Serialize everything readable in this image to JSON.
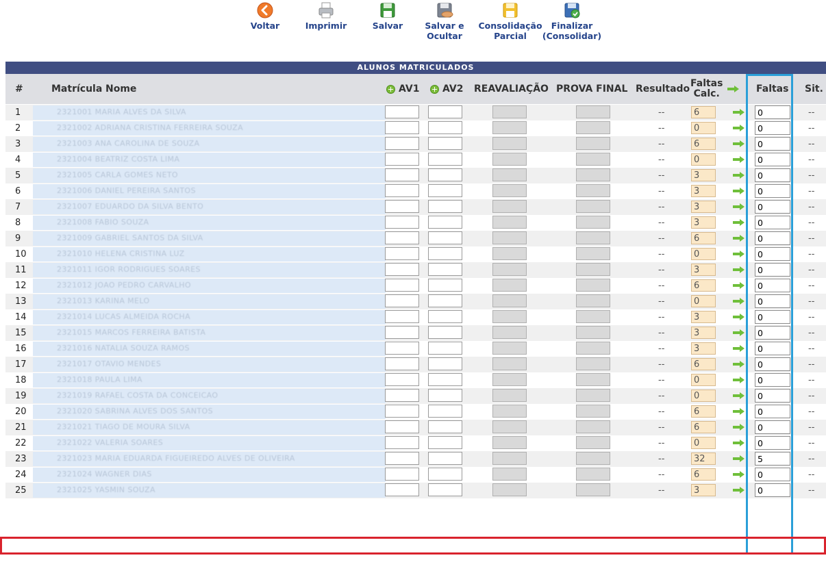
{
  "toolbar": {
    "buttons": [
      {
        "label": "Voltar",
        "icon": "back-icon"
      },
      {
        "label": "Imprimir",
        "icon": "printer-icon"
      },
      {
        "label": "Salvar",
        "icon": "save-icon"
      },
      {
        "label": "Salvar e\nOcultar",
        "icon": "save-hide-icon"
      },
      {
        "label": "Consolidação\nParcial",
        "icon": "partial-consolidation-icon"
      },
      {
        "label": "Finalizar\n(Consolidar)",
        "icon": "finalize-icon"
      }
    ]
  },
  "table": {
    "caption": "Alunos matriculados",
    "headers": {
      "num": "#",
      "matricula": "Matrícula",
      "nome": "Nome",
      "av1": "AV1",
      "av2": "AV2",
      "reavaliacao": "REAVALIAÇÃO",
      "prova_final": "PROVA FINAL",
      "resultado": "Resultado",
      "faltas_calc": "Faltas\nCalc.",
      "faltas": "Faltas",
      "sit": "Sit."
    },
    "rows": [
      {
        "n": "1",
        "faltas_calc": "6",
        "faltas": "0",
        "resultado": "--",
        "sit": "--",
        "blur": "2321001  MARIA ALVES DA SILVA"
      },
      {
        "n": "2",
        "faltas_calc": "0",
        "faltas": "0",
        "resultado": "--",
        "sit": "--",
        "blur": "2321002  ADRIANA CRISTINA FERREIRA SOUZA"
      },
      {
        "n": "3",
        "faltas_calc": "6",
        "faltas": "0",
        "resultado": "--",
        "sit": "--",
        "blur": "2321003  ANA CAROLINA DE SOUZA"
      },
      {
        "n": "4",
        "faltas_calc": "0",
        "faltas": "0",
        "resultado": "--",
        "sit": "--",
        "blur": "2321004  BEATRIZ COSTA LIMA"
      },
      {
        "n": "5",
        "faltas_calc": "3",
        "faltas": "0",
        "resultado": "--",
        "sit": "--",
        "blur": "2321005  CARLA GOMES NETO"
      },
      {
        "n": "6",
        "faltas_calc": "3",
        "faltas": "0",
        "resultado": "--",
        "sit": "--",
        "blur": "2321006  DANIEL PEREIRA SANTOS"
      },
      {
        "n": "7",
        "faltas_calc": "3",
        "faltas": "0",
        "resultado": "--",
        "sit": "--",
        "blur": "2321007  EDUARDO DA SILVA BENTO"
      },
      {
        "n": "8",
        "faltas_calc": "3",
        "faltas": "0",
        "resultado": "--",
        "sit": "--",
        "blur": "2321008  FABIO SOUZA"
      },
      {
        "n": "9",
        "faltas_calc": "6",
        "faltas": "0",
        "resultado": "--",
        "sit": "--",
        "blur": "2321009  GABRIEL SANTOS DA SILVA"
      },
      {
        "n": "10",
        "faltas_calc": "0",
        "faltas": "0",
        "resultado": "--",
        "sit": "--",
        "blur": "2321010  HELENA CRISTINA LUZ"
      },
      {
        "n": "11",
        "faltas_calc": "3",
        "faltas": "0",
        "resultado": "--",
        "sit": "--",
        "blur": "2321011  IGOR RODRIGUES SOARES"
      },
      {
        "n": "12",
        "faltas_calc": "6",
        "faltas": "0",
        "resultado": "--",
        "sit": "--",
        "blur": "2321012  JOAO PEDRO CARVALHO"
      },
      {
        "n": "13",
        "faltas_calc": "0",
        "faltas": "0",
        "resultado": "--",
        "sit": "--",
        "blur": "2321013  KARINA MELO"
      },
      {
        "n": "14",
        "faltas_calc": "3",
        "faltas": "0",
        "resultado": "--",
        "sit": "--",
        "blur": "2321014  LUCAS ALMEIDA ROCHA"
      },
      {
        "n": "15",
        "faltas_calc": "3",
        "faltas": "0",
        "resultado": "--",
        "sit": "--",
        "blur": "2321015  MARCOS FERREIRA BATISTA"
      },
      {
        "n": "16",
        "faltas_calc": "3",
        "faltas": "0",
        "resultado": "--",
        "sit": "--",
        "blur": "2321016  NATALIA SOUZA RAMOS"
      },
      {
        "n": "17",
        "faltas_calc": "6",
        "faltas": "0",
        "resultado": "--",
        "sit": "--",
        "blur": "2321017  OTAVIO MENDES"
      },
      {
        "n": "18",
        "faltas_calc": "0",
        "faltas": "0",
        "resultado": "--",
        "sit": "--",
        "blur": "2321018  PAULA LIMA"
      },
      {
        "n": "19",
        "faltas_calc": "0",
        "faltas": "0",
        "resultado": "--",
        "sit": "--",
        "blur": "2321019  RAFAEL COSTA DA CONCEICAO"
      },
      {
        "n": "20",
        "faltas_calc": "6",
        "faltas": "0",
        "resultado": "--",
        "sit": "--",
        "blur": "2321020  SABRINA ALVES DOS SANTOS"
      },
      {
        "n": "21",
        "faltas_calc": "6",
        "faltas": "0",
        "resultado": "--",
        "sit": "--",
        "blur": "2321021  TIAGO DE MOURA SILVA"
      },
      {
        "n": "22",
        "faltas_calc": "0",
        "faltas": "0",
        "resultado": "--",
        "sit": "--",
        "blur": "2321022  VALERIA SOARES"
      },
      {
        "n": "23",
        "faltas_calc": "32",
        "faltas": "5",
        "resultado": "--",
        "sit": "--",
        "blur": "2321023  MARIA EDUARDA FIGUEIREDO ALVES DE OLIVEIRA"
      },
      {
        "n": "24",
        "faltas_calc": "6",
        "faltas": "0",
        "resultado": "--",
        "sit": "--",
        "blur": "2321024  WAGNER DIAS"
      },
      {
        "n": "25",
        "faltas_calc": "3",
        "faltas": "0",
        "resultado": "--",
        "sit": "--",
        "blur": "2321025  YASMIN SOUZA"
      }
    ]
  },
  "colors": {
    "caption_bg": "#404e82",
    "header_bg": "#dedfe3",
    "calc_bg": "#fbe8c8",
    "highlight_blue": "#2a9fd8",
    "highlight_red": "#d9232d"
  }
}
